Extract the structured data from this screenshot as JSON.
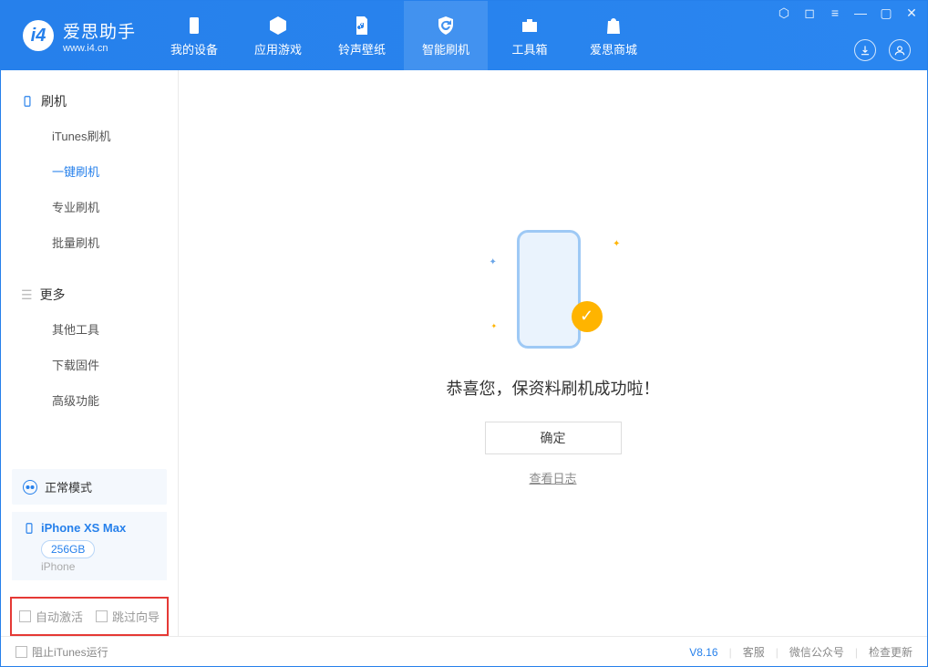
{
  "brand": {
    "name": "爱思助手",
    "url": "www.i4.cn"
  },
  "top_tabs": [
    {
      "label": "我的设备"
    },
    {
      "label": "应用游戏"
    },
    {
      "label": "铃声壁纸"
    },
    {
      "label": "智能刷机"
    },
    {
      "label": "工具箱"
    },
    {
      "label": "爱思商城"
    }
  ],
  "sidebar": {
    "section1_title": "刷机",
    "items1": [
      {
        "label": "iTunes刷机"
      },
      {
        "label": "一键刷机"
      },
      {
        "label": "专业刷机"
      },
      {
        "label": "批量刷机"
      }
    ],
    "section2_title": "更多",
    "items2": [
      {
        "label": "其他工具"
      },
      {
        "label": "下载固件"
      },
      {
        "label": "高级功能"
      }
    ]
  },
  "device": {
    "mode": "正常模式",
    "name": "iPhone XS Max",
    "capacity": "256GB",
    "type": "iPhone"
  },
  "checks": {
    "auto_activate": "自动激活",
    "skip_guide": "跳过向导"
  },
  "result": {
    "message": "恭喜您，保资料刷机成功啦！",
    "ok": "确定",
    "view_log": "查看日志"
  },
  "status": {
    "stop_itunes": "阻止iTunes运行",
    "version": "V8.16",
    "support": "客服",
    "wechat": "微信公众号",
    "check_update": "检查更新"
  }
}
